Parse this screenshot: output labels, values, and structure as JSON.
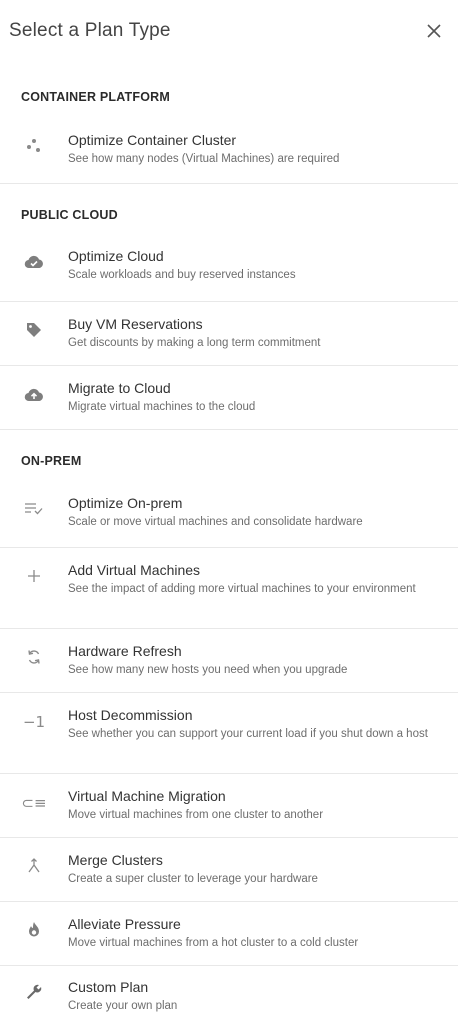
{
  "header": {
    "title": "Select a Plan Type",
    "close_icon": "close-icon"
  },
  "sections": [
    {
      "title": "CONTAINER PLATFORM",
      "items": [
        {
          "icon": "container-nodes-icon",
          "title": "Optimize Container Cluster",
          "description": "See how many nodes (Virtual Machines) are required"
        }
      ]
    },
    {
      "title": "PUBLIC CLOUD",
      "items": [
        {
          "icon": "cloud-check-icon",
          "title": "Optimize Cloud",
          "description": "Scale workloads and buy reserved instances"
        },
        {
          "icon": "tag-icon",
          "title": "Buy VM Reservations",
          "description": "Get discounts by making a long term commitment"
        },
        {
          "icon": "cloud-upload-icon",
          "title": "Migrate to Cloud",
          "description": "Migrate virtual machines to the cloud"
        }
      ]
    },
    {
      "title": "ON-PREM",
      "items": [
        {
          "icon": "list-check-icon",
          "title": "Optimize On-prem",
          "description": "Scale or move virtual machines and consolidate hardware"
        },
        {
          "icon": "plus-icon",
          "title": "Add Virtual Machines",
          "description": "See the impact of adding more virtual machines to your environment"
        },
        {
          "icon": "refresh-icon",
          "title": "Hardware Refresh",
          "description": "See how many new hosts you need when you upgrade"
        },
        {
          "icon": "minus-one-icon",
          "title": "Host Decommission",
          "description": "See whether you can support your current load if you shut down a host"
        },
        {
          "icon": "migrate-icon",
          "title": "Virtual Machine Migration",
          "description": "Move virtual machines from one cluster to another"
        },
        {
          "icon": "merge-icon",
          "title": "Merge Clusters",
          "description": "Create a super cluster to leverage your hardware"
        },
        {
          "icon": "fire-icon",
          "title": "Alleviate Pressure",
          "description": "Move virtual machines from a hot cluster to a cold cluster"
        },
        {
          "icon": "wrench-icon",
          "title": "Custom Plan",
          "description": "Create your own plan"
        }
      ]
    }
  ],
  "icon_glyphs": {
    "minus_one": "−1",
    "migrate": "⊂≡"
  }
}
